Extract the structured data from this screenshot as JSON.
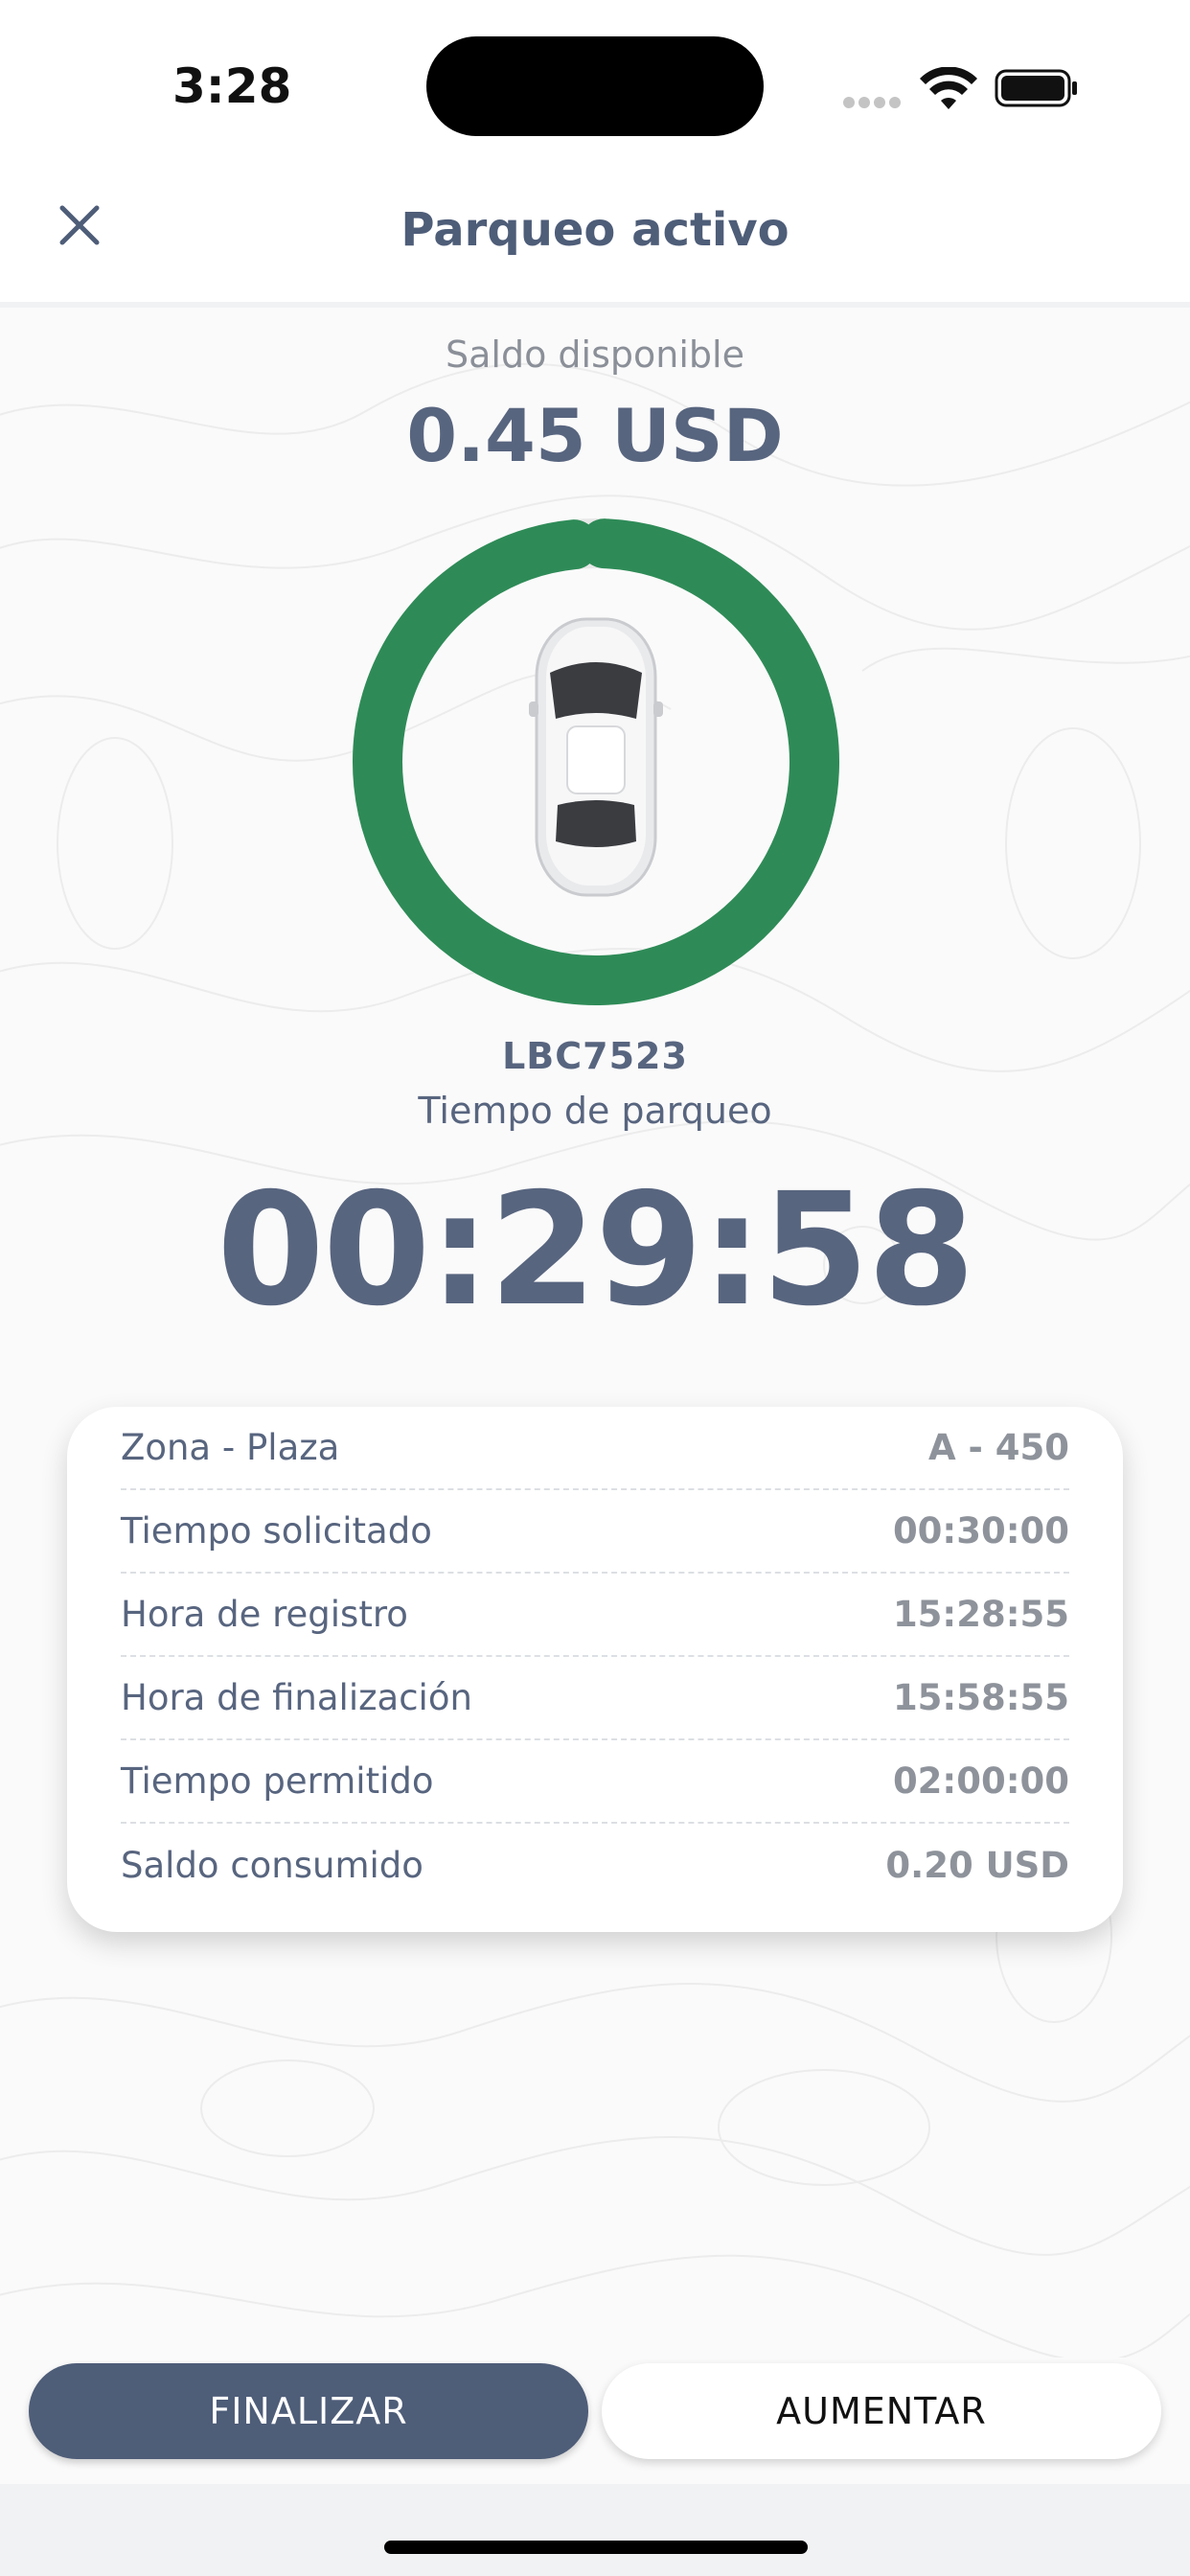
{
  "status_bar": {
    "time": "3:28"
  },
  "header": {
    "title": "Parqueo activo",
    "close_icon": "close-icon"
  },
  "balance": {
    "label": "Saldo disponible",
    "value": "0.45 USD"
  },
  "ring": {
    "color": "#2e8b57",
    "progress": 0.99
  },
  "vehicle": {
    "plate": "LBC7523"
  },
  "timer": {
    "label": "Tiempo de parqueo",
    "value": "00:29:58"
  },
  "details": {
    "rows": [
      {
        "label": "Zona - Plaza",
        "value": "A - 450"
      },
      {
        "label": "Tiempo solicitado",
        "value": "00:30:00"
      },
      {
        "label": "Hora de registro",
        "value": "15:28:55"
      },
      {
        "label": "Hora de finalización",
        "value": "15:58:55"
      },
      {
        "label": "Tiempo permitido",
        "value": "02:00:00"
      },
      {
        "label": "Saldo consumido",
        "value": "0.20 USD"
      }
    ]
  },
  "actions": {
    "finalize_label": "FINALIZAR",
    "increase_label": "AUMENTAR"
  },
  "colors": {
    "primary": "#4e5d78",
    "accent_green": "#2e8b57"
  }
}
